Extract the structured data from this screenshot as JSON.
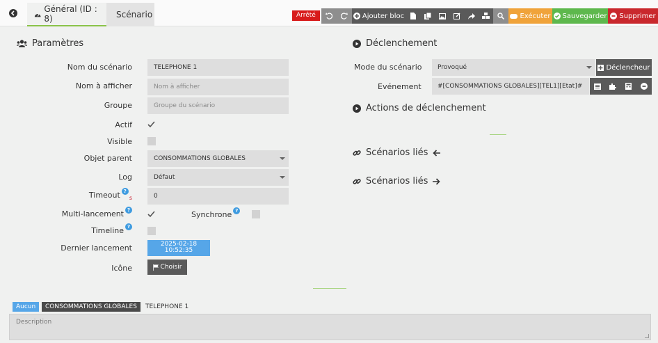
{
  "tabs": {
    "general": "Général (ID : 8)",
    "scenario": "Scénario"
  },
  "toolbar": {
    "status": "Arrêté",
    "add_block": "Ajouter bloc",
    "execute": "Exécuter",
    "save": "Sauvegarder",
    "delete": "Supprimer"
  },
  "params": {
    "title": "Paramètres",
    "name_label": "Nom du scénario",
    "name_value": "TELEPHONE 1",
    "display_label": "Nom à afficher",
    "display_placeholder": "Nom à afficher",
    "group_label": "Groupe",
    "group_placeholder": "Groupe du scénario",
    "active_label": "Actif",
    "visible_label": "Visible",
    "parent_label": "Objet parent",
    "parent_value": "CONSOMMATIONS GLOBALES",
    "log_label": "Log",
    "log_value": "Défaut",
    "timeout_label": "Timeout",
    "timeout_unit": "s",
    "timeout_value": "0",
    "multi_label": "Multi-lancement",
    "sync_label": "Synchrone",
    "timeline_label": "Timeline",
    "last_run_label": "Dernier lancement",
    "last_run_date": "2025-02-18",
    "last_run_time": "10:52:35",
    "icon_label": "Icône",
    "choose_label": "Choisir",
    "help_glyph": "?"
  },
  "trigger": {
    "title": "Déclenchement",
    "mode_label": "Mode du scénario",
    "mode_value": "Provoqué",
    "trigger_button": "Déclencheur",
    "event_label": "Evénement",
    "event_value": "#[CONSOMMATIONS GLOBALES][TEL1][Etat]#",
    "actions_title": "Actions de déclenchement",
    "linked_in": "Scénarios liés",
    "linked_out": "Scénarios liés"
  },
  "breadcrumb": {
    "none": "Aucun",
    "object": "CONSOMMATIONS GLOBALES",
    "name": "TELEPHONE 1"
  },
  "description": {
    "placeholder": "Description"
  },
  "colors": {
    "stopped": "#d81b1b",
    "execute": "#f0a33a",
    "save": "#5eb84d",
    "delete": "#c9282d",
    "date": "#56a6e8"
  }
}
